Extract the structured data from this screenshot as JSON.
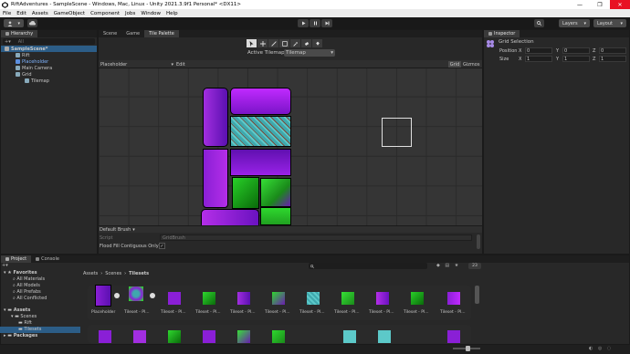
{
  "window": {
    "title": "RiftAdventures - SampleScene - Windows, Mac, Linux - Unity 2021.3.9f1 Personal* <DX11>",
    "controls": [
      "—",
      "❐",
      "✕"
    ]
  },
  "menu": [
    "File",
    "Edit",
    "Assets",
    "GameObject",
    "Component",
    "Jobs",
    "Window",
    "Help"
  ],
  "toolbar": {
    "layers_label": "Layers",
    "layout_label": "Layout"
  },
  "hierarchy": {
    "tab": "Hierarchy",
    "search_placeholder": "All",
    "items": [
      {
        "label": "SampleScene*",
        "indent": 0
      },
      {
        "label": "Rift",
        "indent": 1
      },
      {
        "label": "Placeholder",
        "indent": 1
      },
      {
        "label": "Main Camera",
        "indent": 1
      },
      {
        "label": "Grid",
        "indent": 1
      },
      {
        "label": "Tilemap",
        "indent": 2
      }
    ]
  },
  "center": {
    "tabs": [
      "Scene",
      "Game",
      "Tile Palette"
    ],
    "active_tilemap_label": "Active Tilemap",
    "active_tilemap_value": "Tilemap",
    "palette_value": "Placeholder",
    "edit_label": "Edit",
    "grid_label": "Grid",
    "gizmos_label": "Gizmos",
    "brush_label": "Default Brush",
    "script_label": "Script",
    "script_value": "GridBrush",
    "flood_label": "Flood Fill Contiguous Only",
    "flood_check": "✓"
  },
  "inspector": {
    "tab": "Inspector",
    "title": "Grid Selection",
    "position_label": "Position",
    "size_label": "Size",
    "position": {
      "x": "0",
      "y": "0",
      "z": "0"
    },
    "size": {
      "x": "1",
      "y": "1",
      "z": "1"
    },
    "axis": {
      "x": "X",
      "y": "Y",
      "z": "Z"
    }
  },
  "project": {
    "tabs": [
      "Project",
      "Console"
    ],
    "count_badge": "23",
    "favorites_label": "Favorites",
    "favorites": [
      "All Materials",
      "All Models",
      "All Prefabs",
      "All Conflicted"
    ],
    "assets_label": "Assets",
    "assets_tree": [
      "Scenes",
      "Rift",
      "Tilesets"
    ],
    "packages_label": "Packages",
    "breadcrumb": [
      "Assets",
      "Scenes",
      "Tilesets"
    ],
    "items": [
      "Placeholder",
      "Tileset - Pl...",
      "Tileset - Pl...",
      "Tileset - Pl...",
      "Tileset - Pl...",
      "Tileset - Pl...",
      "Tileset - Pl...",
      "Tileset - Pl...",
      "Tileset - Pl...",
      "Tileset - Pl...",
      "Tileset - Pl...",
      "Tileset - Pl..."
    ]
  },
  "colors": {
    "purple": "#8a1fd6",
    "teal": "#4ab3b8",
    "green": "#2ed82e",
    "selection": "#2c5d87"
  }
}
